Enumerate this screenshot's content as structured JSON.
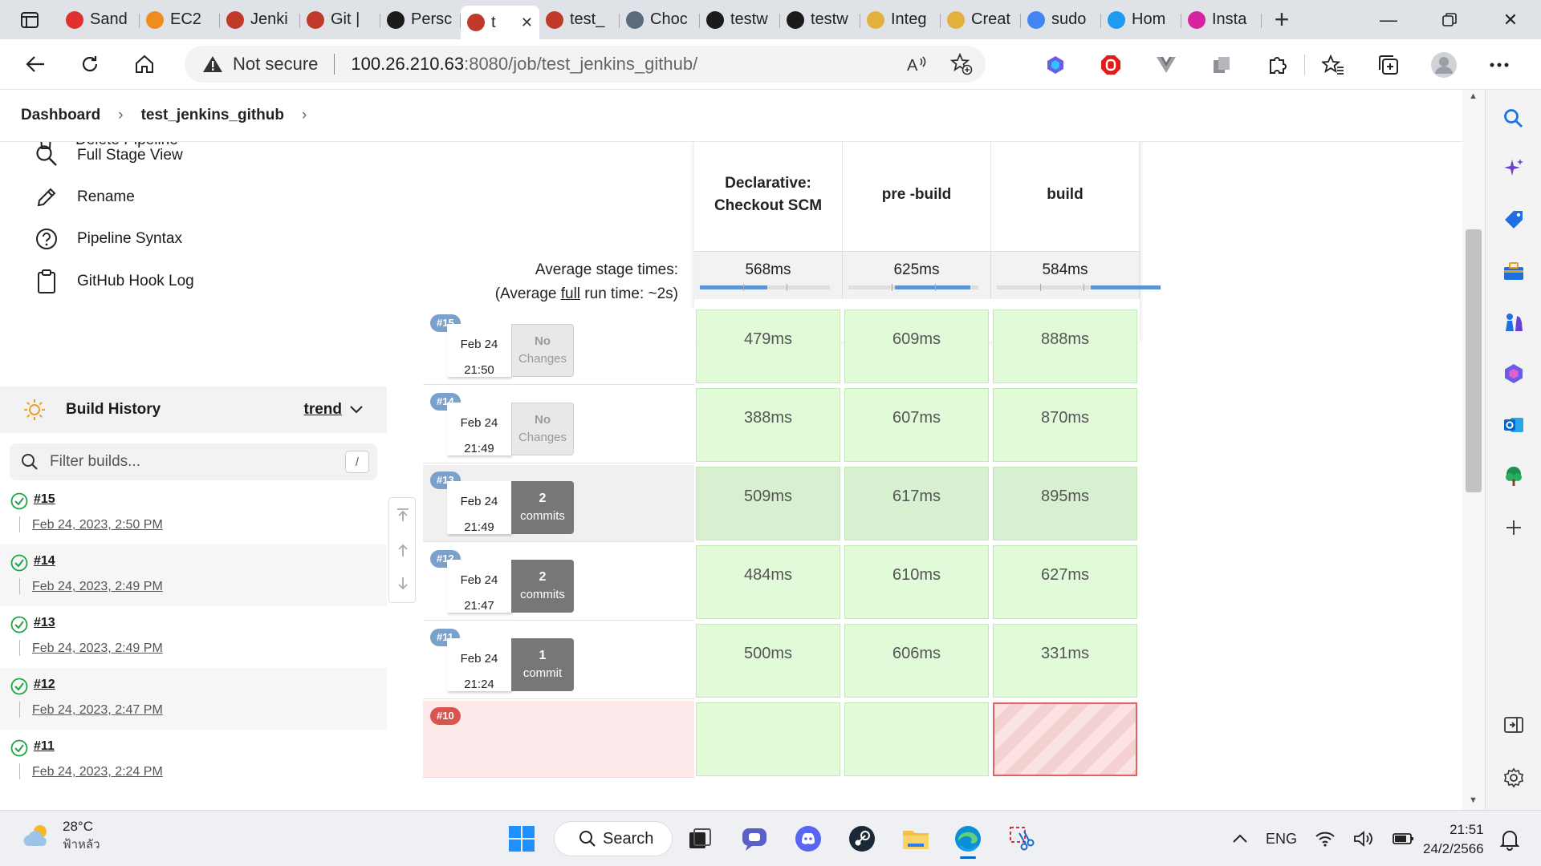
{
  "browser": {
    "tabs": [
      {
        "label": "Sand",
        "icon": "openstack-icon",
        "color": "#e0302f"
      },
      {
        "label": "EC2",
        "icon": "aws-cube-icon",
        "color": "#f08b1d"
      },
      {
        "label": "Jenki",
        "icon": "jenkins-icon",
        "color": "#c0392b"
      },
      {
        "label": "Git |",
        "icon": "jenkins-icon",
        "color": "#c0392b"
      },
      {
        "label": "Persc",
        "icon": "github-icon",
        "color": "#1b1b1b"
      },
      {
        "label": "t",
        "icon": "jenkins-icon",
        "color": "#c0392b",
        "active": true
      },
      {
        "label": "test_",
        "icon": "jenkins-icon",
        "color": "#c0392b"
      },
      {
        "label": "Choc",
        "icon": "chocolatey-icon",
        "color": "#5a6b7e"
      },
      {
        "label": "testw",
        "icon": "github-icon",
        "color": "#1b1b1b"
      },
      {
        "label": "testw",
        "icon": "github-icon",
        "color": "#1b1b1b"
      },
      {
        "label": "Integ",
        "icon": "box-icon",
        "color": "#e2b13c"
      },
      {
        "label": "Creat",
        "icon": "box-icon",
        "color": "#e2b13c"
      },
      {
        "label": "sudo",
        "icon": "google-icon",
        "color": "#4285f4"
      },
      {
        "label": "Hom",
        "icon": "twitter-icon",
        "color": "#1d9bf0"
      },
      {
        "label": "Insta",
        "icon": "instagram-icon",
        "color": "#d6249f"
      }
    ],
    "security_label": "Not secure",
    "url_host": "100.26.210.63",
    "url_rest": ":8080/job/test_jenkins_github/"
  },
  "breadcrumb": {
    "root": "Dashboard",
    "job": "test_jenkins_github"
  },
  "sidebar": {
    "tasks": [
      {
        "label": "Full Stage View",
        "icon": "search-icon"
      },
      {
        "label": "Rename",
        "icon": "pencil-icon"
      },
      {
        "label": "Pipeline Syntax",
        "icon": "question-circle-icon"
      },
      {
        "label": "GitHub Hook Log",
        "icon": "clipboard-icon"
      }
    ],
    "partial_task": "Delete Pipeline",
    "build_history_title": "Build History",
    "trend_label": "trend",
    "filter_placeholder": "Filter builds...",
    "filter_shortcut": "/",
    "builds": [
      {
        "number": "#15",
        "date": "Feb 24, 2023, 2:50 PM"
      },
      {
        "number": "#14",
        "date": "Feb 24, 2023, 2:49 PM"
      },
      {
        "number": "#13",
        "date": "Feb 24, 2023, 2:49 PM"
      },
      {
        "number": "#12",
        "date": "Feb 24, 2023, 2:47 PM"
      },
      {
        "number": "#11",
        "date": "Feb 24, 2023, 2:24 PM"
      }
    ]
  },
  "stage_view": {
    "stages": [
      {
        "name": "Declarative: Checkout SCM",
        "avg": "568ms",
        "avg_fraction": 0.26
      },
      {
        "name": "pre -build",
        "avg": "625ms",
        "avg_fraction": 0.29
      },
      {
        "name": "build",
        "avg": "584ms",
        "avg_fraction": 0.27
      }
    ],
    "avg_label": "Average stage times:",
    "avg_full_prefix": "(Average ",
    "avg_full_link": "full",
    "avg_full_suffix": " run time: ~2s)",
    "runs": [
      {
        "badge": "#15",
        "date": "Feb 24",
        "time": "21:50",
        "changes_top": "No",
        "changes_bottom": "Changes",
        "has_changes": false,
        "durations": [
          "479ms",
          "609ms",
          "888ms"
        ]
      },
      {
        "badge": "#14",
        "date": "Feb 24",
        "time": "21:49",
        "changes_top": "No",
        "changes_bottom": "Changes",
        "has_changes": false,
        "durations": [
          "388ms",
          "607ms",
          "870ms"
        ]
      },
      {
        "badge": "#13",
        "date": "Feb 24",
        "time": "21:49",
        "changes_top": "2",
        "changes_bottom": "commits",
        "has_changes": true,
        "durations": [
          "509ms",
          "617ms",
          "895ms"
        ]
      },
      {
        "badge": "#12",
        "date": "Feb 24",
        "time": "21:47",
        "changes_top": "2",
        "changes_bottom": "commits",
        "has_changes": true,
        "durations": [
          "484ms",
          "610ms",
          "627ms"
        ]
      },
      {
        "badge": "#11",
        "date": "Feb 24",
        "time": "21:24",
        "changes_top": "1",
        "changes_bottom": "commit",
        "has_changes": true,
        "durations": [
          "500ms",
          "606ms",
          "331ms"
        ]
      }
    ],
    "partial_run_badge": "#10"
  },
  "taskbar": {
    "weather_temp": "28°C",
    "weather_desc": "ฟ้าหลัว",
    "search_label": "Search",
    "lang": "ENG",
    "time": "21:51",
    "date": "24/2/2566"
  }
}
